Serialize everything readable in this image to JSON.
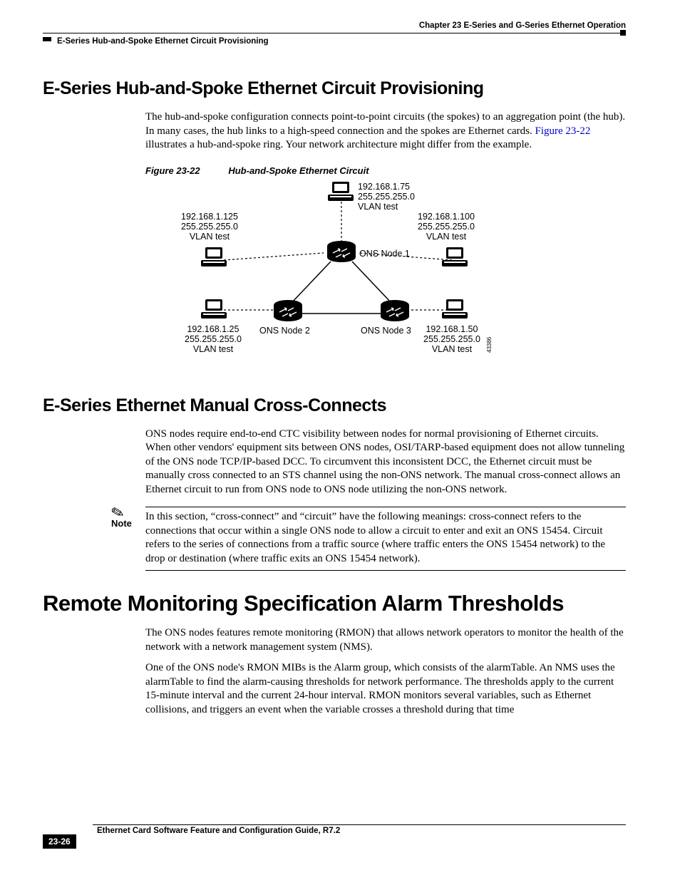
{
  "header": {
    "chapter": "Chapter 23 E-Series and G-Series Ethernet Operation",
    "section": "E-Series Hub-and-Spoke Ethernet Circuit Provisioning"
  },
  "sect1": {
    "title": "E-Series Hub-and-Spoke Ethernet Circuit Provisioning",
    "para": "The hub-and-spoke configuration connects point-to-point circuits (the spokes) to an aggregation point (the hub). In many cases, the hub links to a high-speed connection and the spokes are Ethernet cards. ",
    "figref": "Figure 23-22",
    "para_tail": " illustrates a hub-and-spoke ring. Your network architecture might differ from the example."
  },
  "figure": {
    "number": "Figure 23-22",
    "title": "Hub-and-Spoke Ethernet Circuit",
    "nodes": {
      "top": {
        "ip": "192.168.1.75",
        "mask": "255.255.255.0",
        "vlan": "VLAN test"
      },
      "left": {
        "ip": "192.168.1.125",
        "mask": "255.255.255.0",
        "vlan": "VLAN test"
      },
      "right": {
        "ip": "192.168.1.100",
        "mask": "255.255.255.0",
        "vlan": "VLAN test"
      },
      "bl": {
        "ip": "192.168.1.25",
        "mask": "255.255.255.0",
        "vlan": "VLAN test"
      },
      "br": {
        "ip": "192.168.1.50",
        "mask": "255.255.255.0",
        "vlan": "VLAN test"
      }
    },
    "ons": {
      "n1": "ONS Node 1",
      "n2": "ONS Node 2",
      "n3": "ONS Node 3"
    },
    "artid": "43386"
  },
  "sect2": {
    "title": "E-Series Ethernet Manual Cross-Connects",
    "para": "ONS nodes require end-to-end CTC visibility between nodes for normal provisioning of Ethernet circuits. When other vendors' equipment sits between ONS nodes, OSI/TARP-based equipment does not allow tunneling of the ONS node TCP/IP-based DCC. To circumvent this inconsistent DCC, the Ethernet circuit must be manually cross connected to an STS channel using the non-ONS network. The manual cross-connect allows an Ethernet circuit to run from ONS node to ONS node utilizing the non-ONS network."
  },
  "note": {
    "label": "Note",
    "text": "In this section, “cross-connect” and “circuit” have the following meanings: cross-connect refers to the connections that occur within a single ONS node to allow a circuit to enter and exit an ONS 15454. Circuit refers to the series of connections from a traffic source (where traffic enters the ONS 15454 network) to the drop or destination (where traffic exits an ONS 15454 network)."
  },
  "sect3": {
    "title": "Remote Monitoring Specification Alarm Thresholds",
    "p1": "The ONS nodes features remote monitoring (RMON) that allows network operators to monitor the health of the network with a network management system (NMS).",
    "p2": "One of the ONS node's RMON MIBs is the Alarm group, which consists of the alarmTable. An NMS uses the alarmTable to find the alarm-causing thresholds for network performance. The thresholds apply to the current 15-minute interval and the current 24-hour interval. RMON monitors several variables, such as Ethernet collisions, and triggers an event when the variable crosses a threshold during that time"
  },
  "footer": {
    "title": "Ethernet Card Software Feature and Configuration Guide, R7.2",
    "page": "23-26"
  }
}
